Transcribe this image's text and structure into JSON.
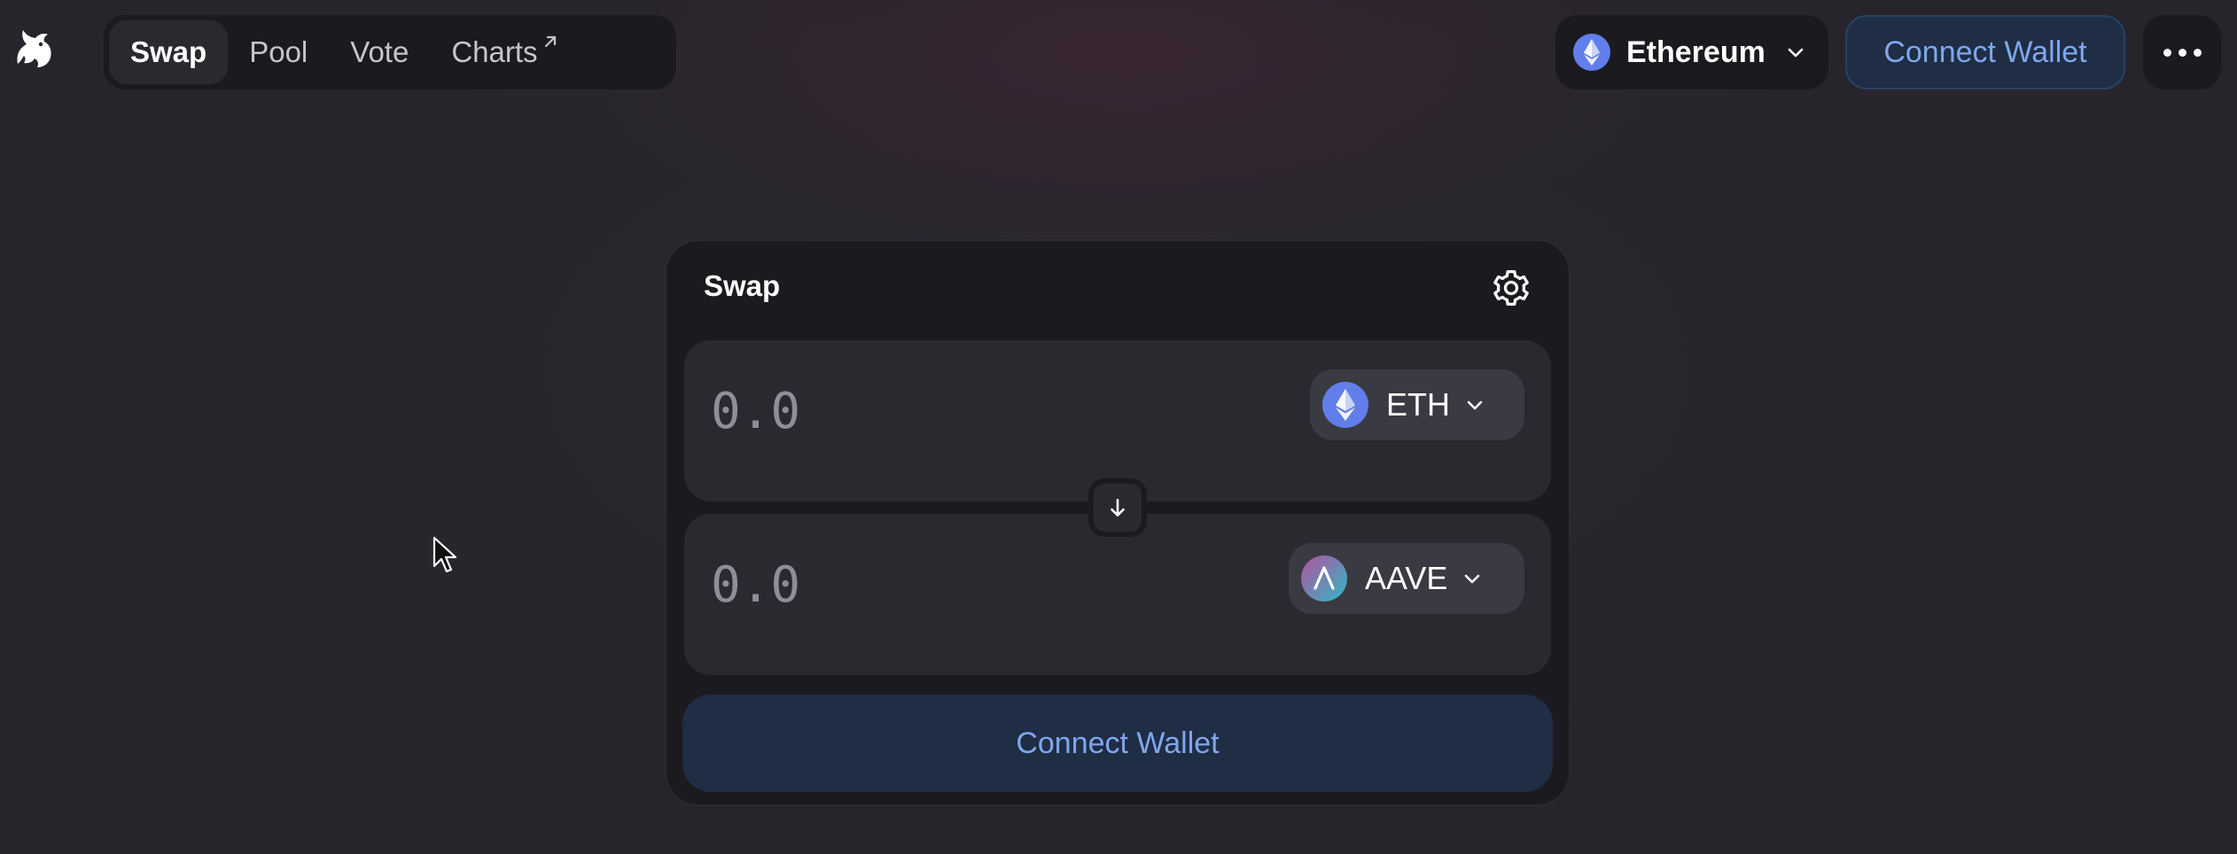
{
  "header": {
    "logo_icon": "uniswap-unicorn-icon",
    "nav": [
      {
        "label": "Swap",
        "active": true
      },
      {
        "label": "Pool",
        "active": false
      },
      {
        "label": "Vote",
        "active": false
      },
      {
        "label": "Charts",
        "active": false,
        "external_icon": "arrow-up-right-icon"
      }
    ],
    "network": {
      "label": "Ethereum",
      "icon": "ethereum-icon"
    },
    "connect_label": "Connect Wallet",
    "more_icon": "more-horizontal-icon"
  },
  "swap": {
    "title": "Swap",
    "settings_icon": "gear-icon",
    "input": {
      "placeholder": "0.0",
      "token": "ETH",
      "token_icon": "ethereum-icon"
    },
    "output": {
      "placeholder": "0.0",
      "token": "AAVE",
      "token_icon": "aave-icon"
    },
    "switch_icon": "arrow-down-icon",
    "connect_label": "Connect Wallet"
  },
  "colors": {
    "background": "#27252b",
    "surface": "#1b1b1f",
    "panel": "#29292f",
    "token_button": "#3a3a42",
    "accent_bg": "#1f2d45",
    "accent_text": "#7fa7ec",
    "eth": "#627eea"
  }
}
